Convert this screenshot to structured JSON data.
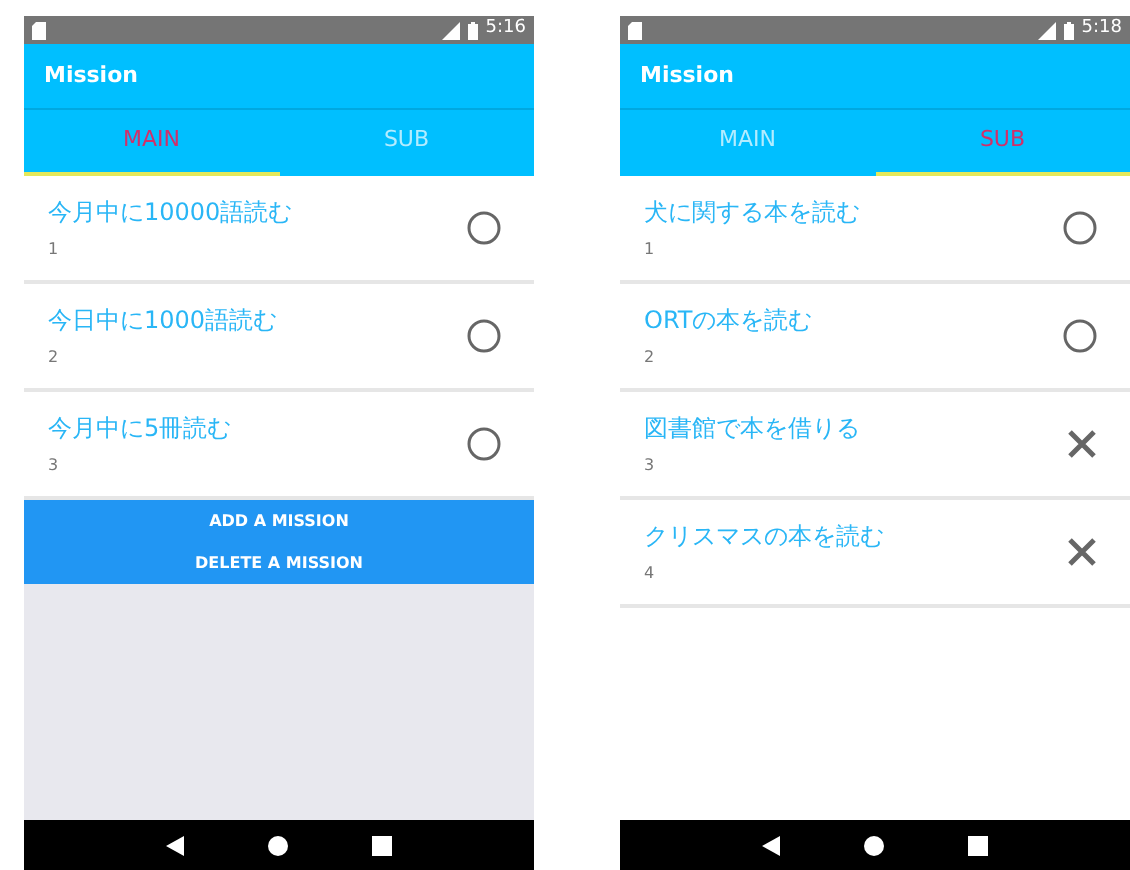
{
  "screens": [
    {
      "status_time": "5:16",
      "title": "Mission",
      "tabs": [
        {
          "label": "MAIN",
          "selected": true
        },
        {
          "label": "SUB",
          "selected": false
        }
      ],
      "missions": [
        {
          "title": "今月中に10000語読む",
          "number": "1",
          "completed": false
        },
        {
          "title": "今日中に1000語読む",
          "number": "2",
          "completed": false
        },
        {
          "title": "今月中に5冊読む",
          "number": "3",
          "completed": false
        }
      ],
      "buttons": [
        "ADD A MISSION",
        "DELETE A MISSION"
      ]
    },
    {
      "status_time": "5:18",
      "title": "Mission",
      "tabs": [
        {
          "label": "MAIN",
          "selected": false
        },
        {
          "label": "SUB",
          "selected": true
        }
      ],
      "missions": [
        {
          "title": "犬に関する本を読む",
          "number": "1",
          "completed": false
        },
        {
          "title": "ORTの本を読む",
          "number": "2",
          "completed": false
        },
        {
          "title": "図書館で本を借りる",
          "number": "3",
          "completed": true
        },
        {
          "title": "クリスマスの本を読む",
          "number": "4",
          "completed": true
        }
      ]
    }
  ]
}
